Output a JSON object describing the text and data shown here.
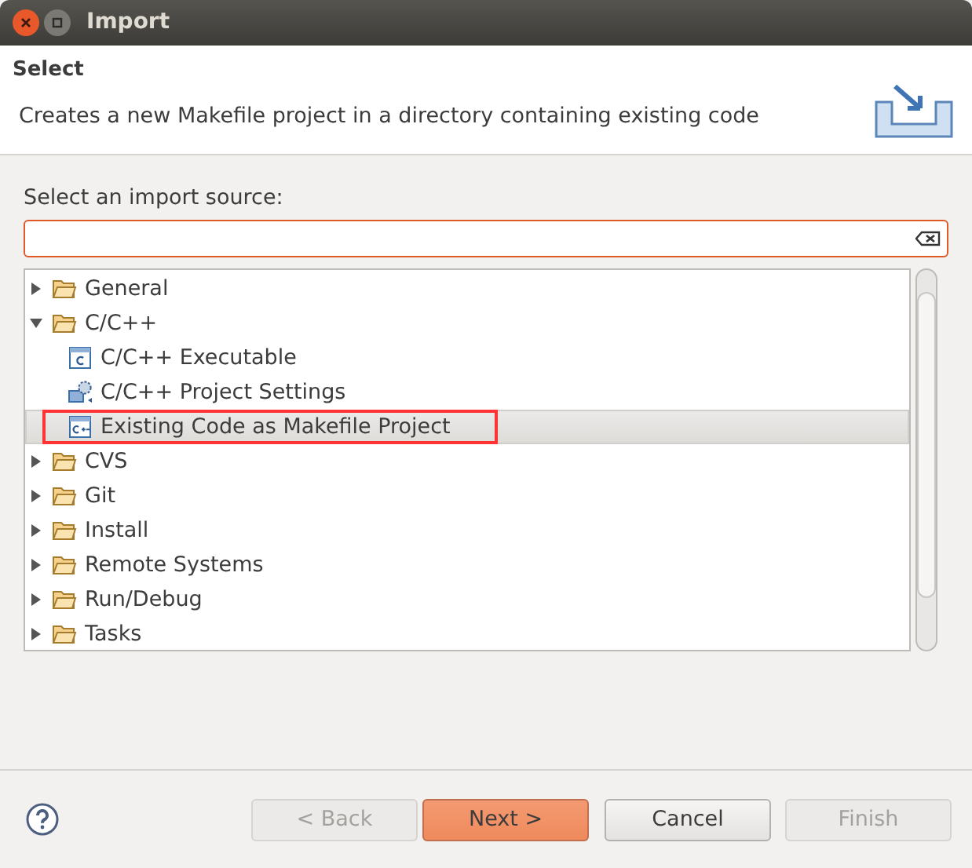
{
  "window": {
    "title": "Import"
  },
  "header": {
    "title": "Select",
    "description": "Creates a new Makefile project in a directory containing existing code"
  },
  "source_label": "Select an import source:",
  "tree": [
    {
      "label": "General",
      "kind": "folder",
      "expanded": false,
      "selected": false
    },
    {
      "label": "C/C++",
      "kind": "folder",
      "expanded": true,
      "selected": false,
      "children": [
        {
          "label": "C/C++ Executable",
          "kind": "c-file",
          "selected": false
        },
        {
          "label": "C/C++ Project Settings",
          "kind": "settings",
          "selected": false
        },
        {
          "label": "Existing Code as Makefile Project",
          "kind": "cpp-file",
          "selected": true,
          "annotated": true
        }
      ]
    },
    {
      "label": "CVS",
      "kind": "folder",
      "expanded": false,
      "selected": false
    },
    {
      "label": "Git",
      "kind": "folder",
      "expanded": false,
      "selected": false
    },
    {
      "label": "Install",
      "kind": "folder",
      "expanded": false,
      "selected": false
    },
    {
      "label": "Remote Systems",
      "kind": "folder",
      "expanded": false,
      "selected": false
    },
    {
      "label": "Run/Debug",
      "kind": "folder",
      "expanded": false,
      "selected": false
    },
    {
      "label": "Tasks",
      "kind": "folder",
      "expanded": false,
      "selected": false
    }
  ],
  "buttons": [
    {
      "label": "< Back",
      "disabled": true,
      "default": false
    },
    {
      "label": "Next >",
      "disabled": false,
      "default": true
    },
    {
      "label": "Cancel",
      "disabled": false,
      "default": false
    },
    {
      "label": "Finish",
      "disabled": true,
      "default": false
    }
  ]
}
